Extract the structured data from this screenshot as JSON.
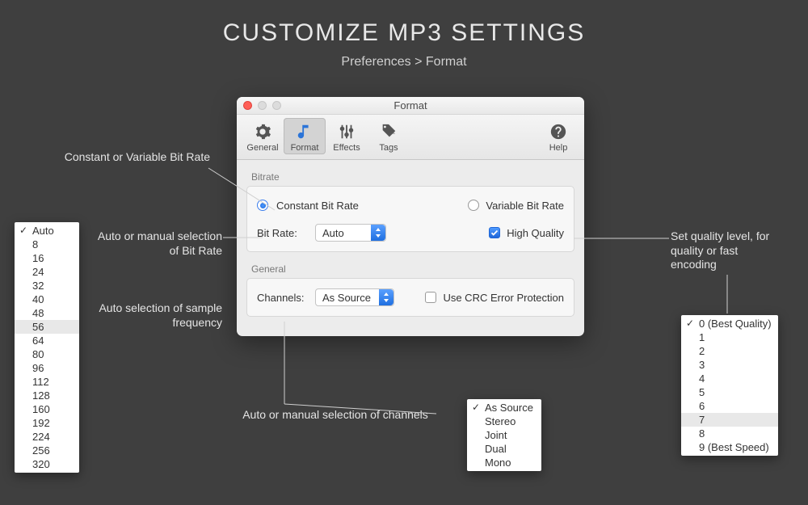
{
  "page": {
    "title": "CUSTOMIZE MP3 SETTINGS",
    "breadcrumb": "Preferences > Format"
  },
  "window": {
    "title": "Format",
    "toolbar": {
      "general": "General",
      "format": "Format",
      "effects": "Effects",
      "tags": "Tags",
      "help": "Help"
    },
    "bitrate": {
      "section": "Bitrate",
      "cbr": "Constant Bit Rate",
      "vbr": "Variable Bit Rate",
      "field_label": "Bit Rate:",
      "select_value": "Auto",
      "hq": "High Quality"
    },
    "general": {
      "section": "General",
      "channels_label": "Channels:",
      "channels_value": "As Source",
      "crc": "Use CRC Error Protection"
    }
  },
  "callouts": {
    "bitrate_mode": "Constant or Variable Bit Rate",
    "bitrate_select": "Auto or manual selection of Bit Rate",
    "sample_freq": "Auto selection of sample frequency",
    "channels_select": "Auto or manual selection of channels",
    "quality": "Set quality level, for quality or fast encoding"
  },
  "popover_bitrate": {
    "items": [
      "Auto",
      "8",
      "16",
      "24",
      "32",
      "40",
      "48",
      "56",
      "64",
      "80",
      "96",
      "112",
      "128",
      "160",
      "192",
      "224",
      "256",
      "320"
    ],
    "checked": "Auto",
    "highlighted": "56"
  },
  "popover_channels": {
    "items": [
      "As Source",
      "Stereo",
      "Joint",
      "Dual",
      "Mono"
    ],
    "checked": "As Source"
  },
  "popover_quality": {
    "items": [
      "0 (Best Quality)",
      "1",
      "2",
      "3",
      "4",
      "5",
      "6",
      "7",
      "8",
      "9 (Best Speed)"
    ],
    "checked": "0 (Best Quality)",
    "highlighted": "7"
  }
}
